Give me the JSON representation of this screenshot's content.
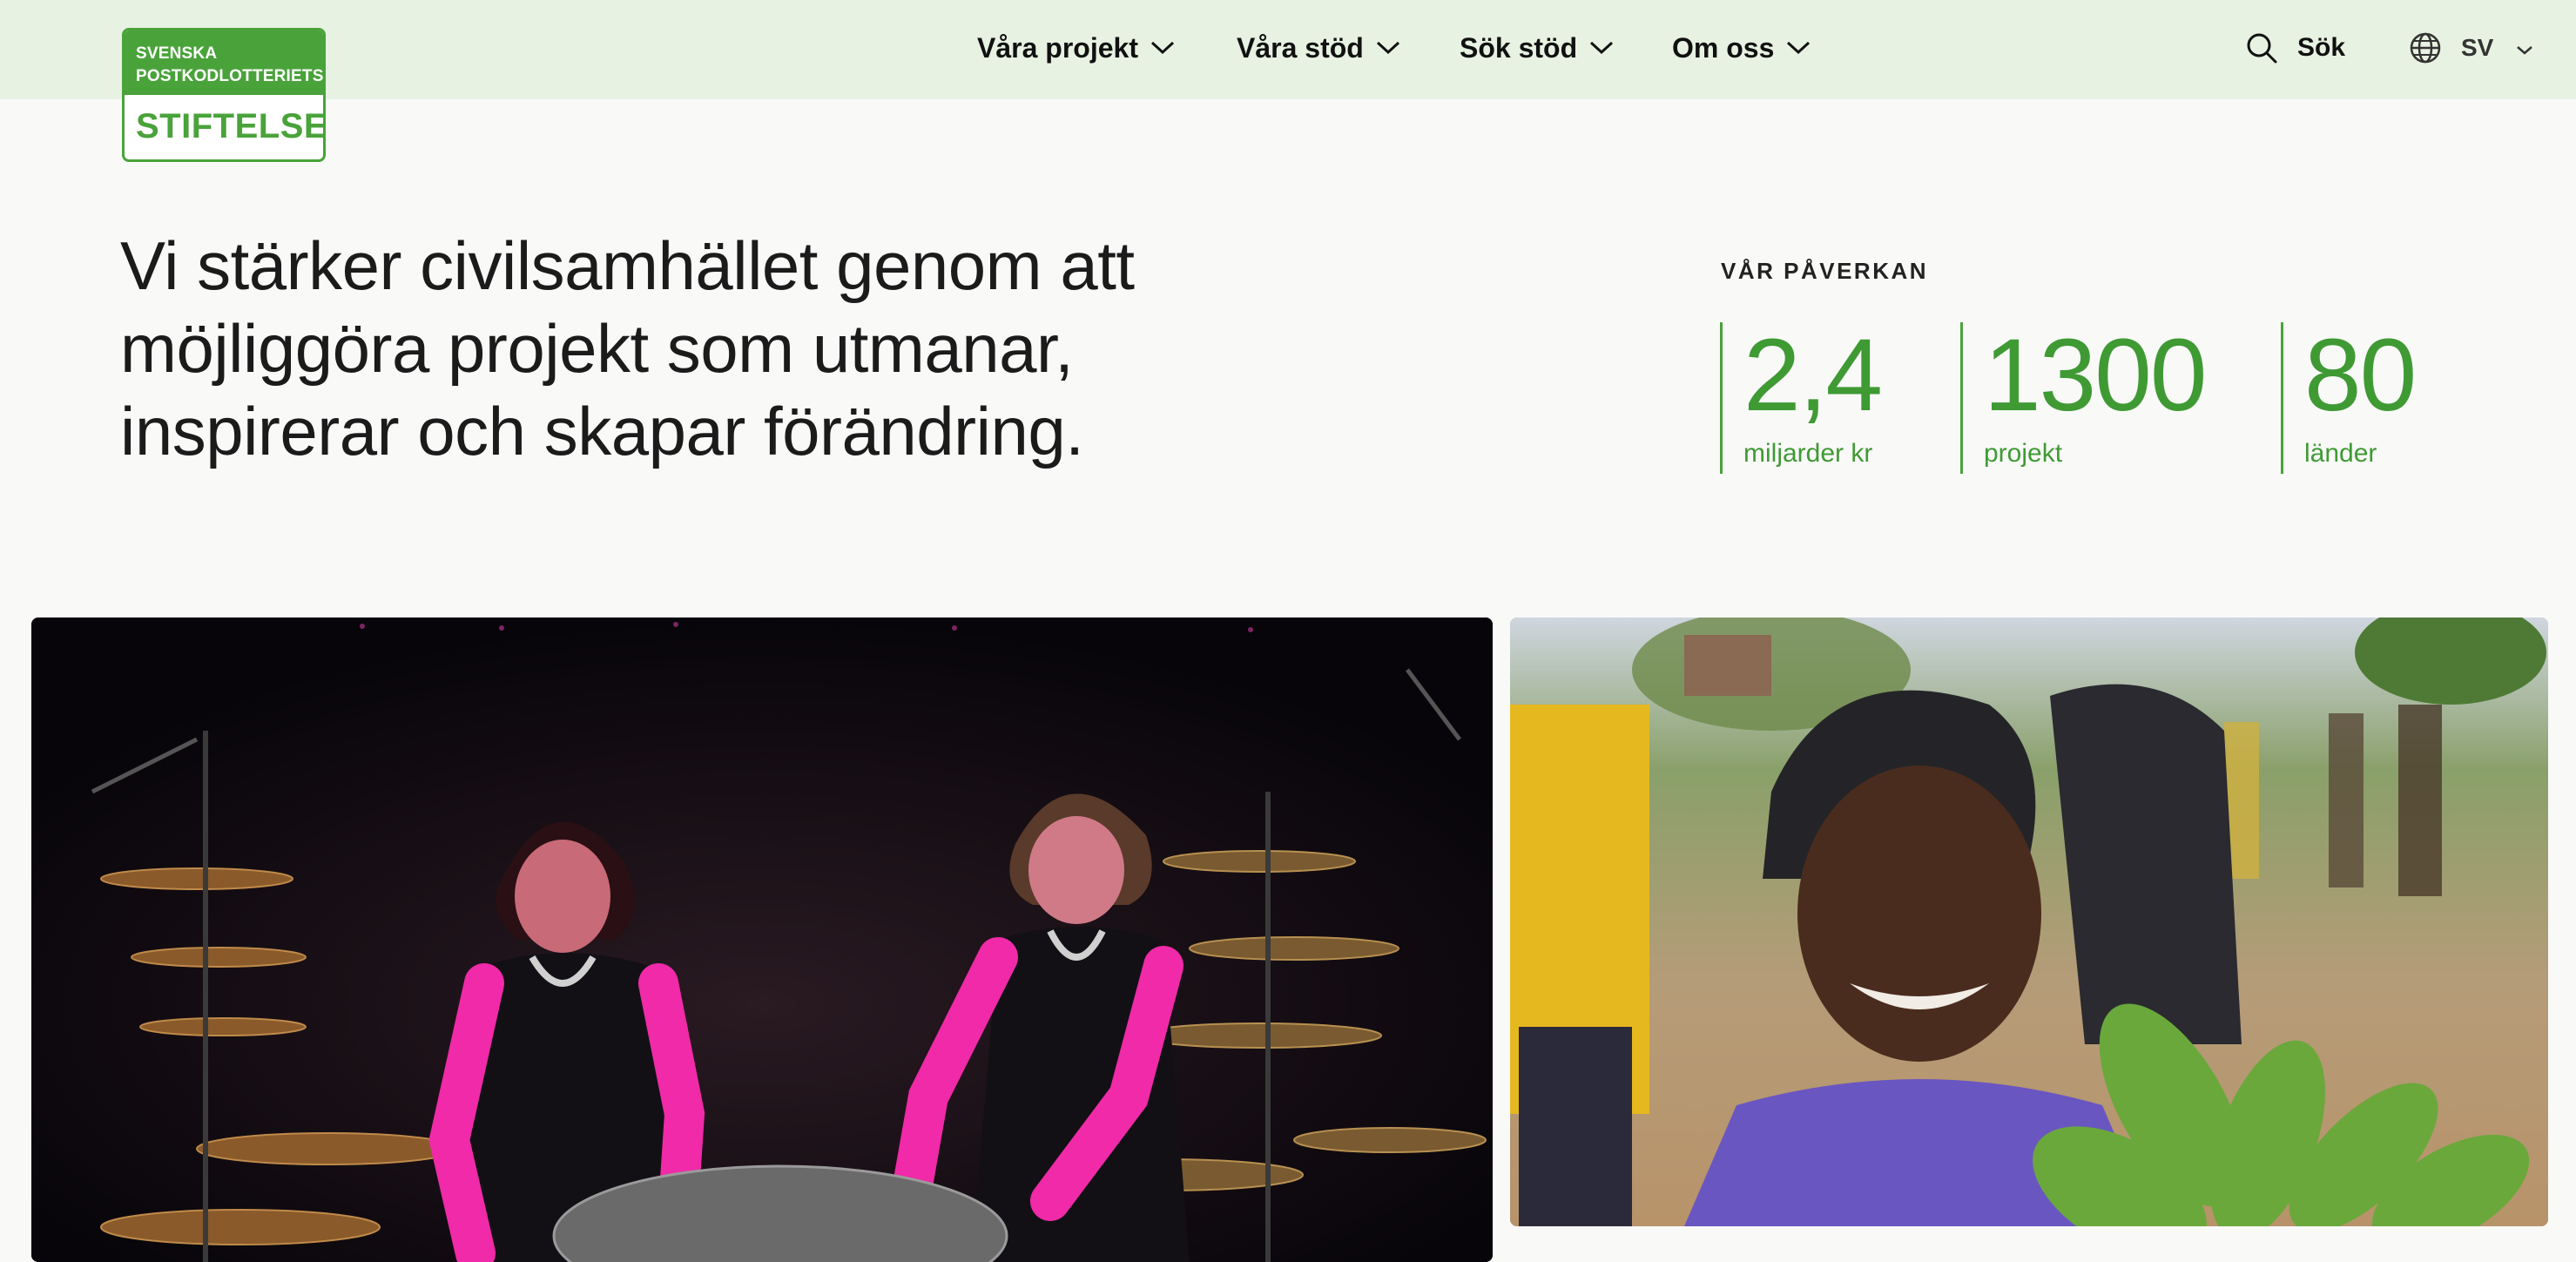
{
  "logo": {
    "line1": "SVENSKA",
    "line2": "POSTKODLOTTERIETS",
    "line3": "STIFTELSE"
  },
  "nav": {
    "items": [
      {
        "label": "Våra projekt"
      },
      {
        "label": "Våra stöd"
      },
      {
        "label": "Sök stöd"
      },
      {
        "label": "Om oss"
      }
    ],
    "search_label": "Sök",
    "language_label": "SV"
  },
  "hero": {
    "tagline_line1": "Vi stärker civilsamhället genom att",
    "tagline_line2": "möjliggöra projekt som utmanar,",
    "tagline_line3": "inspirerar och skapar förändring."
  },
  "impact": {
    "title": "VÅR PÅVERKAN",
    "stats": [
      {
        "value": "2,4",
        "unit": "miljarder kr"
      },
      {
        "value": "1300",
        "unit": "projekt"
      },
      {
        "value": "80",
        "unit": "länder"
      }
    ]
  },
  "colors": {
    "brand_green": "#49a33a",
    "header_bg": "#e7f2e2",
    "page_bg": "#f9f9f8"
  },
  "icons": [
    "chevron-down-icon",
    "search-icon",
    "globe-icon"
  ]
}
